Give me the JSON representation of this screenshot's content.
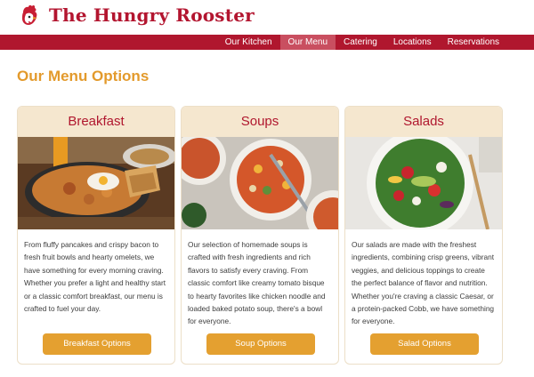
{
  "brand": {
    "name": "The Hungry Rooster",
    "accent": "#b0172e",
    "gold": "#e4a030"
  },
  "nav": {
    "items": [
      {
        "label": "Our Kitchen"
      },
      {
        "label": "Our Menu",
        "active": true
      },
      {
        "label": "Catering"
      },
      {
        "label": "Locations"
      },
      {
        "label": "Reservations"
      }
    ]
  },
  "page": {
    "title": "Our Menu Options"
  },
  "cards": [
    {
      "title": "Breakfast",
      "image": "breakfast-plate",
      "text": "From fluffy pancakes and crispy bacon to fresh fruit bowls and hearty omelets, we have something for every morning craving. Whether you prefer a light and healthy start or a classic comfort breakfast, our menu is crafted to fuel your day.",
      "button": "Breakfast Options"
    },
    {
      "title": "Soups",
      "image": "soup-bowls",
      "text": "Our selection of homemade soups is crafted with fresh ingredients and rich flavors to satisfy every craving. From classic comfort like creamy tomato bisque to hearty favorites like chicken noodle and loaded baked potato soup, there's a bowl for everyone.",
      "button": "Soup Options"
    },
    {
      "title": "Salads",
      "image": "salad-bowl",
      "text": "Our salads are made with the freshest ingredients, combining crisp greens, vibrant veggies, and delicious toppings to create the perfect balance of flavor and nutrition. Whether you're craving a classic Caesar, or a protein-packed Cobb, we have something for everyone.",
      "button": "Salad Options"
    }
  ]
}
